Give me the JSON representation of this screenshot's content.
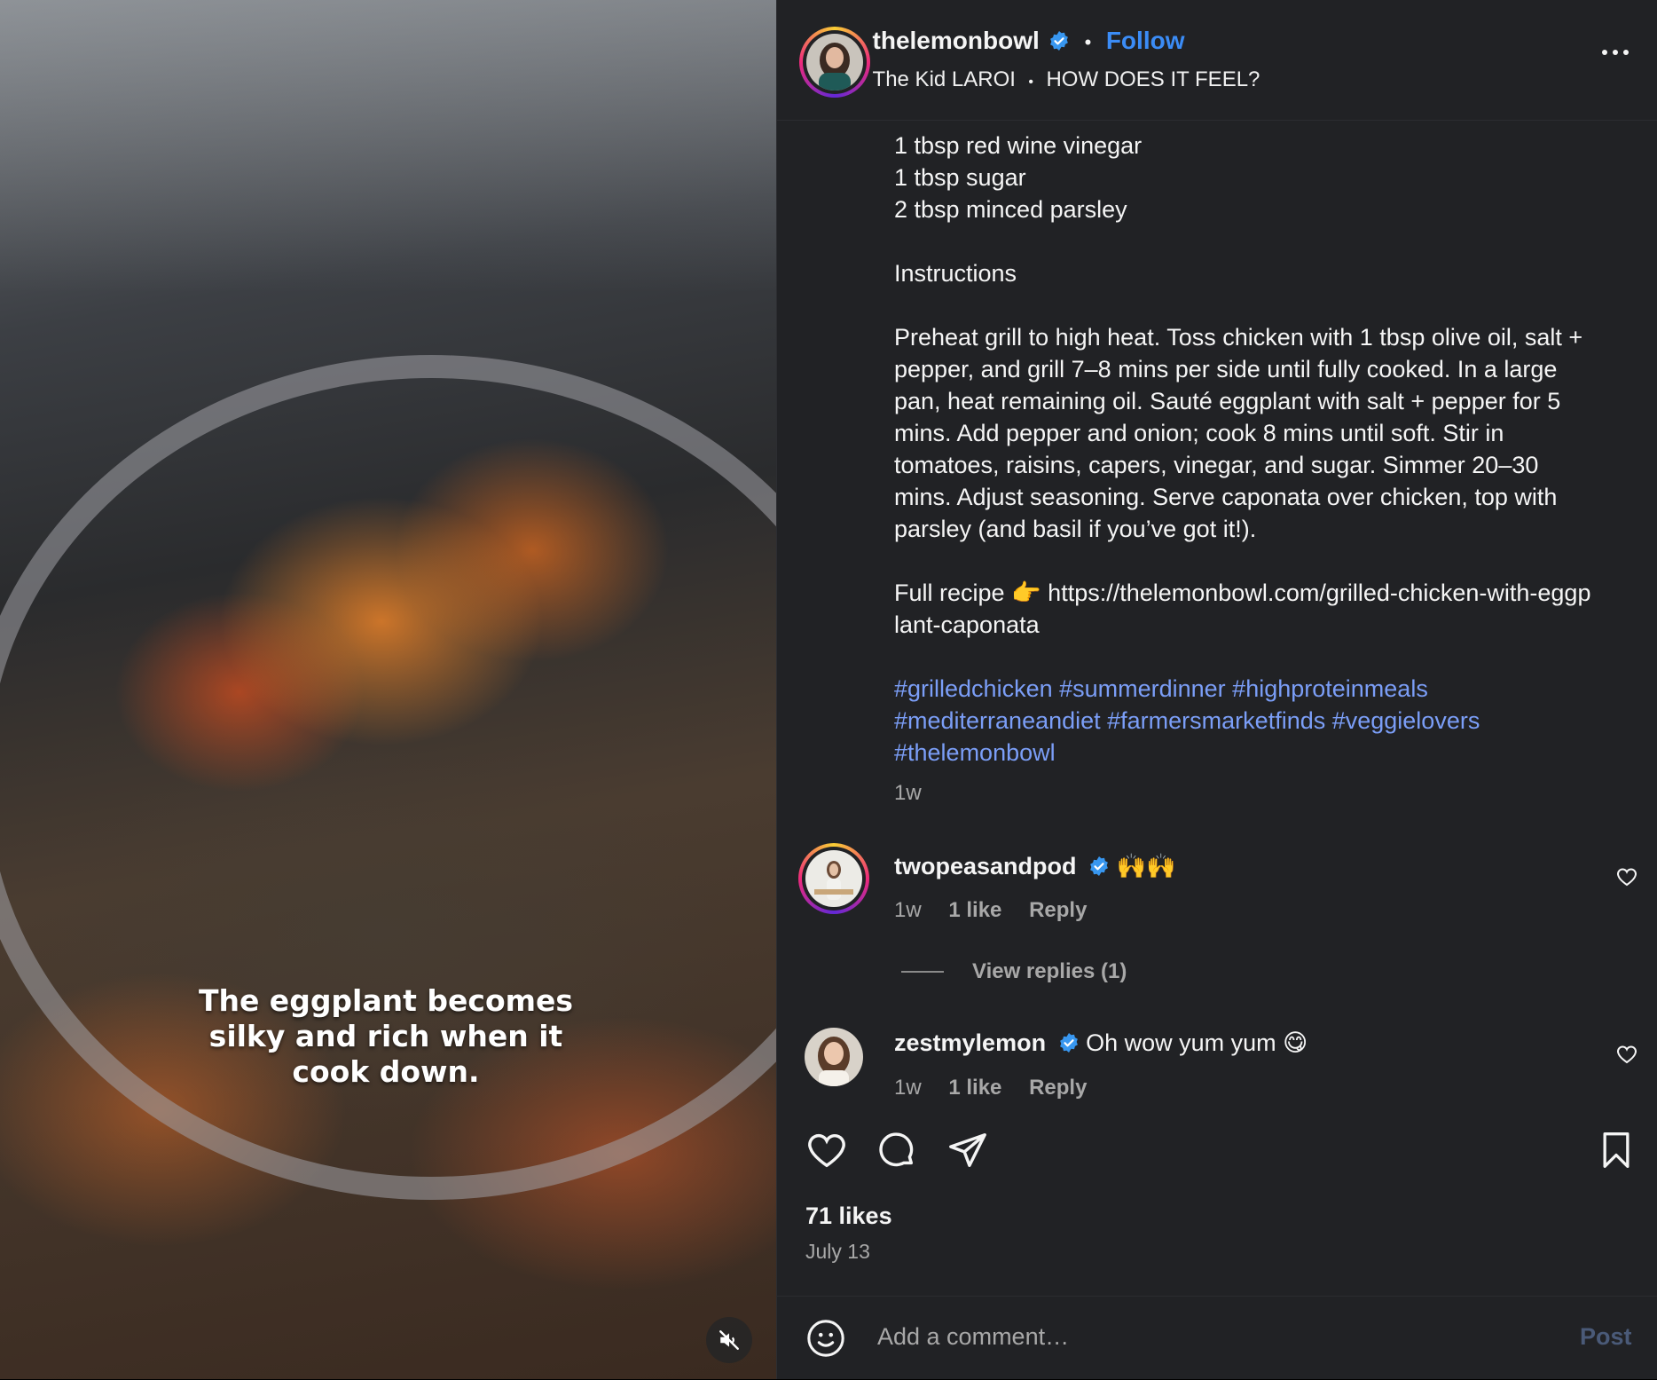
{
  "video": {
    "caption": "The eggplant becomes silky and rich when it cook down.",
    "mute_icon": "speaker-muted-icon"
  },
  "post": {
    "username": "thelemonbowl",
    "follow_label": "Follow",
    "audio_artist": "The Kid LAROI",
    "audio_track": "HOW DOES IT FEEL?",
    "more_label": "..."
  },
  "caption": {
    "lines": [
      "1 tbsp red wine vinegar",
      "1 tbsp sugar",
      "2 tbsp minced parsley"
    ],
    "heading": "Instructions",
    "instructions": "Preheat grill to high heat. Toss chicken with 1 tbsp olive oil, salt + pepper, and grill 7–8 mins per side until fully cooked. In a large pan, heat remaining oil. Sauté eggplant with salt + pepper for 5 mins. Add pepper and onion; cook 8 mins until soft. Stir in tomatoes, raisins, capers, vinegar, and sugar. Simmer 20–30 mins. Adjust seasoning. Serve caponata over chicken, top with parsley (and basil if you’ve got it!).",
    "recipe_prefix": "Full recipe 👉 ",
    "recipe_url": "https://thelemonbowl.com/grilled-chicken-with-eggplant-caponata",
    "hashtags_line1": "#grilledchicken #summerdinner #highproteinmeals",
    "hashtags_line2": "#mediterraneandiet #farmersmarketfinds #veggielovers",
    "hashtags_line3": "#thelemonbowl",
    "age": "1w"
  },
  "comments": [
    {
      "username": "twopeasandpod",
      "text": "🙌🙌",
      "time": "1w",
      "likes": "1 like",
      "reply_label": "Reply",
      "view_replies": "View replies (1)"
    },
    {
      "username": "zestmylemon",
      "text": "Oh wow yum yum 😋",
      "time": "1w",
      "likes": "1 like",
      "reply_label": "Reply"
    }
  ],
  "footer": {
    "likes": "71 likes",
    "date": "July 13",
    "comment_placeholder": "Add a comment…",
    "post_label": "Post"
  },
  "colors": {
    "panel_bg": "#212225",
    "link_blue": "#3b8cf6",
    "hashtag": "#7b9ef7",
    "verified": "#3897f0"
  }
}
